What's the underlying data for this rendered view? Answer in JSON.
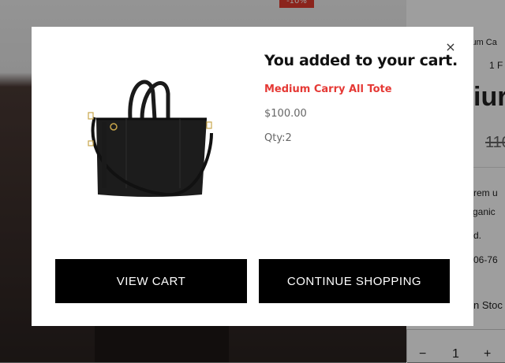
{
  "background_page": {
    "sale_badge": "-10%",
    "breadcrumb": "ium Ca",
    "pagination": "1 F",
    "title_fragment": "iur",
    "old_price": "110",
    "desc_line1": "rem u",
    "desc_line2": "rganic",
    "desc_line3": "d.",
    "desc_line4": "06-76",
    "stock": "n Stoc",
    "qty_minus": "−",
    "qty_value": "1",
    "qty_plus": "+"
  },
  "modal": {
    "close_label": "×",
    "heading": "You added to your cart.",
    "product_name": "Medium Carry All Tote",
    "price": "$100.00",
    "quantity": "Qty:2",
    "product_image_icon": "black-tote-bag-image",
    "buttons": {
      "view_cart": "VIEW CART",
      "continue_shopping": "CONTINUE SHOPPING"
    }
  },
  "colors": {
    "accent": "#e53935",
    "button_bg": "#000000",
    "button_text": "#ffffff",
    "overlay": "rgba(0,0,0,0.38)"
  }
}
